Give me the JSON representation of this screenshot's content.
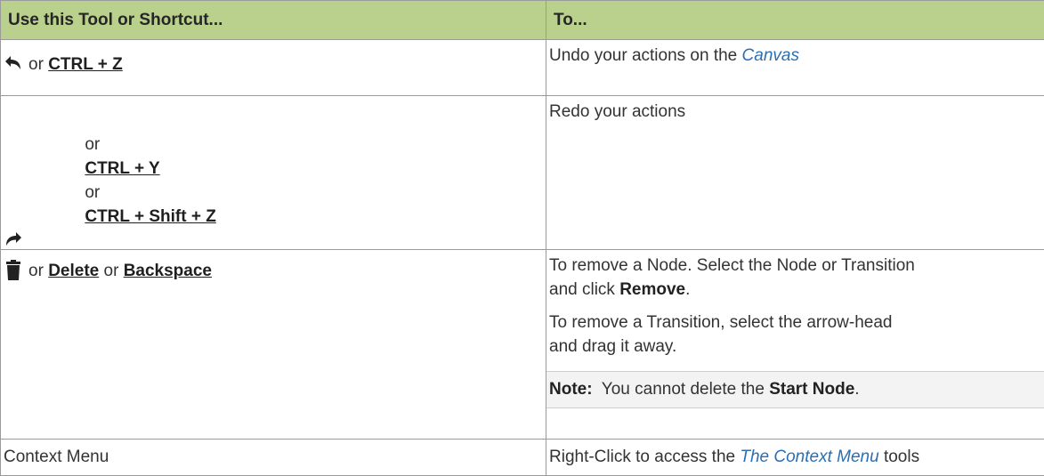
{
  "header": {
    "col1": "Use this Tool or Shortcut...",
    "col2": "To..."
  },
  "rows": [
    {
      "icon": "undo-icon",
      "or1": "or",
      "key1": "CTRL + Z",
      "desc_pre": "Undo your actions on the ",
      "desc_link": "Canvas"
    },
    {
      "icon": "redo-icon",
      "or1": "or",
      "key1": "CTRL + Y",
      "or2": "or",
      "key2": "CTRL + Shift + Z",
      "desc": "Redo your actions"
    },
    {
      "icon": "trash-icon",
      "or1": "or",
      "key1": "Delete",
      "or2": "or",
      "key2": "Backspace",
      "desc1_line1": "To remove a Node. Select the Node or Transition",
      "desc1_line2_pre": "and click ",
      "desc1_bold": "Remove",
      "desc1_post": ".",
      "desc2_line1": "To remove a Transition, select the arrow-head",
      "desc2_line2": "and drag it away.",
      "note_label": "Note:",
      "note_pre": "You cannot delete the ",
      "note_bold": "Start Node",
      "note_post": "."
    },
    {
      "tool": "Context Menu",
      "desc_pre": "Right-Click to access the ",
      "desc_link": "The Context Menu",
      "desc_post": " tools"
    }
  ],
  "colors": {
    "header_bg": "#b9d18c",
    "link": "#2a6fb5",
    "note_bg": "#f3f3f3"
  }
}
